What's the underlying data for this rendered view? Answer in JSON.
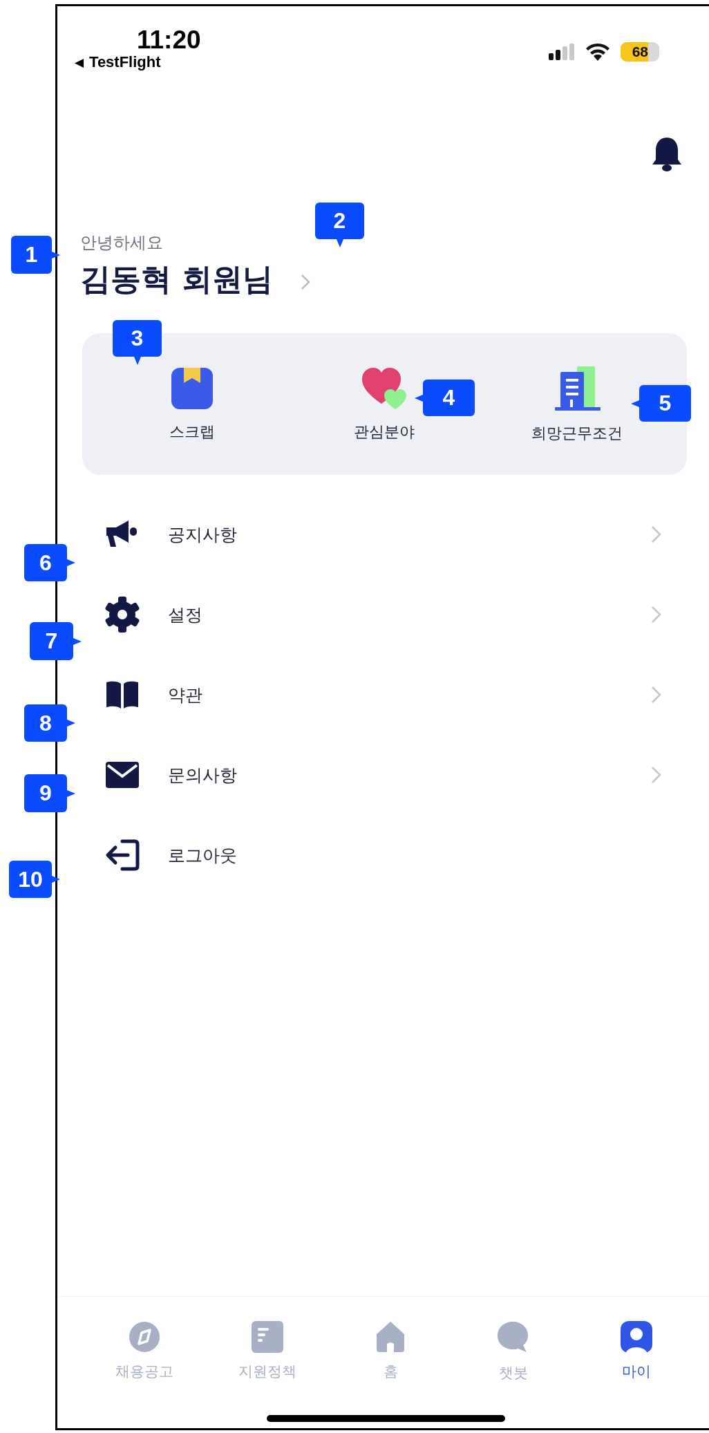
{
  "status_bar": {
    "time": "11:20",
    "back_arrow": "◀",
    "back_label": "TestFlight",
    "battery": "68"
  },
  "greeting": "안녕하세요",
  "user_name": "김동혁 회원님",
  "quick_menu": [
    {
      "kind": "scrap",
      "label": "스크랩"
    },
    {
      "kind": "interest",
      "label": "관심분야"
    },
    {
      "kind": "workplace",
      "label": "희망근무조건"
    }
  ],
  "menu": [
    {
      "kind": "notice",
      "label": "공지사항",
      "chevron": true
    },
    {
      "kind": "settings",
      "label": "설정",
      "chevron": true
    },
    {
      "kind": "terms",
      "label": "약관",
      "chevron": true
    },
    {
      "kind": "inquiry",
      "label": "문의사항",
      "chevron": true
    },
    {
      "kind": "logout",
      "label": "로그아웃",
      "chevron": false
    }
  ],
  "tabs": [
    {
      "kind": "jobs",
      "label": "채용공고",
      "selected": false
    },
    {
      "kind": "policy",
      "label": "지원정책",
      "selected": false
    },
    {
      "kind": "home",
      "label": "홈",
      "selected": false
    },
    {
      "kind": "chatbot",
      "label": "챗봇",
      "selected": false
    },
    {
      "kind": "my",
      "label": "마이",
      "selected": true
    }
  ],
  "callouts": [
    {
      "number": "1"
    },
    {
      "number": "2"
    },
    {
      "number": "3"
    },
    {
      "number": "4"
    },
    {
      "number": "5"
    },
    {
      "number": "6"
    },
    {
      "number": "7"
    },
    {
      "number": "8"
    },
    {
      "number": "9"
    },
    {
      "number": "10"
    }
  ]
}
